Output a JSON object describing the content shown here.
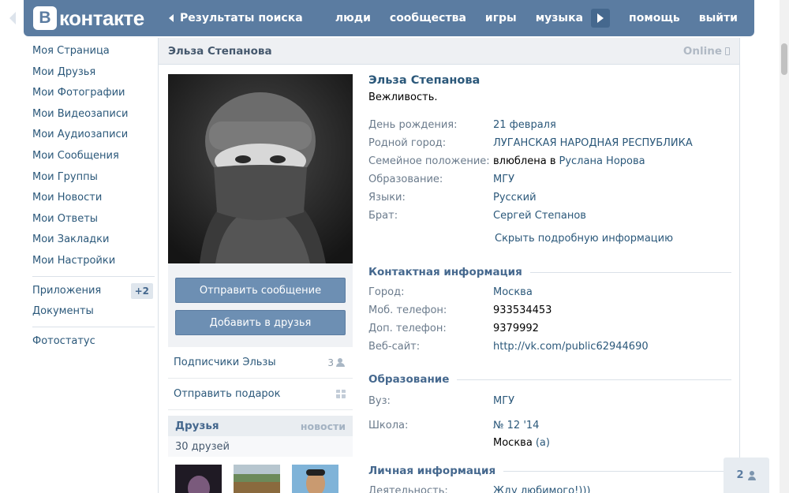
{
  "header": {
    "logo_letter": "В",
    "logo_text": "контакте",
    "back_label": "Результаты поиска",
    "nav": [
      "люди",
      "сообщества",
      "игры",
      "музыка",
      "помощь",
      "выйти"
    ]
  },
  "menu": {
    "items": [
      "Моя Страница",
      "Мои Друзья",
      "Мои Фотографии",
      "Мои Видеозаписи",
      "Мои Аудиозаписи",
      "Мои Сообщения",
      "Мои Группы",
      "Мои Новости",
      "Мои Ответы",
      "Мои Закладки",
      "Мои Настройки"
    ],
    "apps": "Приложения",
    "apps_badge": "+2",
    "docs": "Документы",
    "photostatus": "Фотостатус"
  },
  "profile": {
    "header_name": "Эльза Степанова",
    "online": "Online",
    "name": "Эльза Степанова",
    "status": "Вежливость.",
    "birthday_k": "День рождения:",
    "birthday_v": "21 февраля",
    "hometown_k": "Родной город:",
    "hometown_v": "ЛУГАНСКАЯ НАРОДНАЯ РЕСПУБЛИКА",
    "family_k": "Семейное положение:",
    "family_v": "влюблена в",
    "family_link": "Руслана Норова",
    "edu_k": "Образование:",
    "edu_v": "МГУ",
    "lang_k": "Языки:",
    "lang_v": "Русский",
    "brother_k": "Брат:",
    "brother_v": "Сергей Степанов",
    "toggle": "Скрыть подробную информацию",
    "contacts_title": "Контактная информация",
    "city_k": "Город:",
    "city_v": "Москва",
    "mob_k": "Моб. телефон:",
    "mob_v": "933534453",
    "phone_k": "Доп. телефон:",
    "phone_v": "9379992",
    "site_k": "Веб-сайт:",
    "site_v": "http://vk.com/public62944690",
    "education_title": "Образование",
    "uni_k": "Вуз:",
    "uni_v": "МГУ",
    "school_k": "Школа:",
    "school_v": "№ 12 '14",
    "school_city": "Москва",
    "school_class": "(а)",
    "personal_title": "Личная информация",
    "activity_k": "Деятельность:",
    "activity_v": "Жду любимого!)))"
  },
  "side": {
    "send_message": "Отправить сообщение",
    "add_friend": "Добавить в друзья",
    "followers": "Подписчики Эльзы",
    "followers_count": "3",
    "gift": "Отправить подарок",
    "friends_title": "Друзья",
    "friends_news": "новости",
    "friends_count": "30 друзей"
  },
  "friends_online": {
    "count": "2"
  },
  "colors": {
    "brand": "#5b7ca1",
    "link": "#2b587a",
    "button": "#6d8fb3"
  }
}
